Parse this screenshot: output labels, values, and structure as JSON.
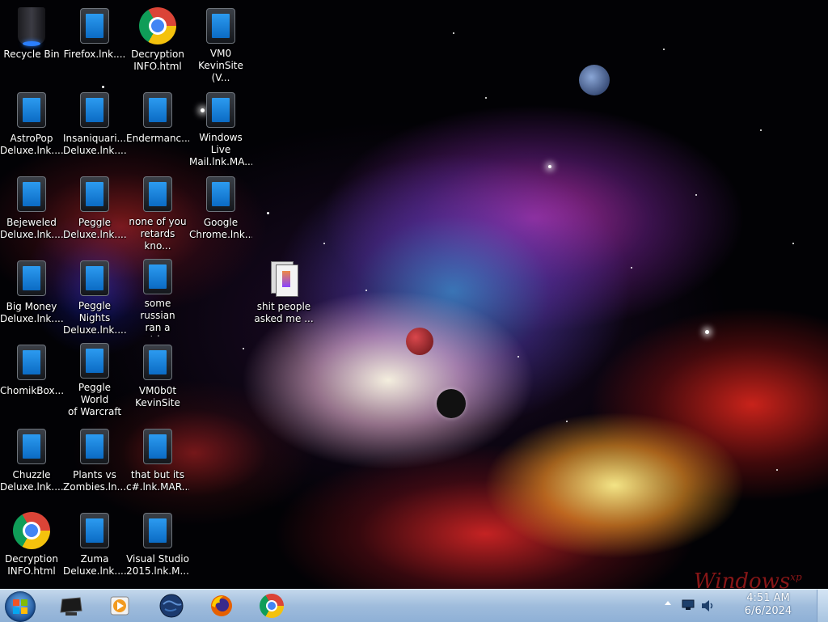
{
  "desktop": {
    "icons": [
      {
        "id": "recycle-bin",
        "label": "Recycle Bin",
        "type": "recycle"
      },
      {
        "id": "firefox-lnk",
        "label": "Firefox.lnk....",
        "type": "doc"
      },
      {
        "id": "decryption-info-top",
        "label": "Decryption\nINFO.html",
        "type": "chrome"
      },
      {
        "id": "vm0-kevinsite",
        "label": "VM0\nKevinSite (V...",
        "type": "doc"
      },
      {
        "id": "astropop",
        "label": "AstroPop\nDeluxe.lnk....",
        "type": "doc"
      },
      {
        "id": "insaniquarium",
        "label": "Insaniquari...\nDeluxe.lnk....",
        "type": "doc"
      },
      {
        "id": "enderman",
        "label": "Endermanc...",
        "type": "doc"
      },
      {
        "id": "windows-live-mail",
        "label": "Windows Live\nMail.lnk.MA...",
        "type": "doc"
      },
      {
        "id": "bejeweled",
        "label": "Bejeweled\nDeluxe.lnk....",
        "type": "doc"
      },
      {
        "id": "peggle",
        "label": "Peggle\nDeluxe.lnk....",
        "type": "doc"
      },
      {
        "id": "none-of-you",
        "label": "none of you\nretards kno...",
        "type": "doc"
      },
      {
        "id": "google-chrome-lnk",
        "label": "Google\nChrome.lnk....",
        "type": "doc"
      },
      {
        "id": "big-money",
        "label": "Big Money\nDeluxe.lnk....",
        "type": "doc"
      },
      {
        "id": "peggle-nights",
        "label": "Peggle Nights\nDeluxe.lnk....",
        "type": "doc"
      },
      {
        "id": "some-russian",
        "label": "some russian\nran a rat.ln...",
        "type": "doc"
      },
      {
        "id": "shit-people",
        "label": "shit people\nasked me ...",
        "type": "folder"
      },
      {
        "id": "chomikbox",
        "label": "ChomikBox....",
        "type": "doc"
      },
      {
        "id": "peggle-world",
        "label": "Peggle World\nof Warcraft ...",
        "type": "doc"
      },
      {
        "id": "vm0b0t",
        "label": "VM0b0t\nKevinSite",
        "type": "doc"
      },
      {
        "id": "chuzzle",
        "label": "Chuzzle\nDeluxe.lnk....",
        "type": "doc"
      },
      {
        "id": "plants-vs-zombies",
        "label": "Plants vs\nZombies.ln...",
        "type": "doc"
      },
      {
        "id": "that-but-its-c",
        "label": "that but its\nc#.lnk.MAR...",
        "type": "doc"
      },
      {
        "id": "decryption-info-bottom",
        "label": "Decryption\nINFO.html",
        "type": "chrome"
      },
      {
        "id": "zuma",
        "label": "Zuma\nDeluxe.lnk....",
        "type": "doc"
      },
      {
        "id": "visual-studio",
        "label": "Visual Studio\n2015.lnk.M...",
        "type": "doc"
      }
    ],
    "wallpaper_brand": "Windows",
    "wallpaper_brand_sup": "xp"
  },
  "taskbar": {
    "pinned": [
      "mycomputer",
      "media-player",
      "ie-globe",
      "firefox",
      "chrome"
    ],
    "clock_time": "4:51 AM",
    "clock_date": "6/6/2024"
  },
  "colors": {
    "taskbar_top": "#c4d8ec",
    "taskbar_bottom": "#8eb0d6",
    "doc_blue": "#1f85e0"
  }
}
